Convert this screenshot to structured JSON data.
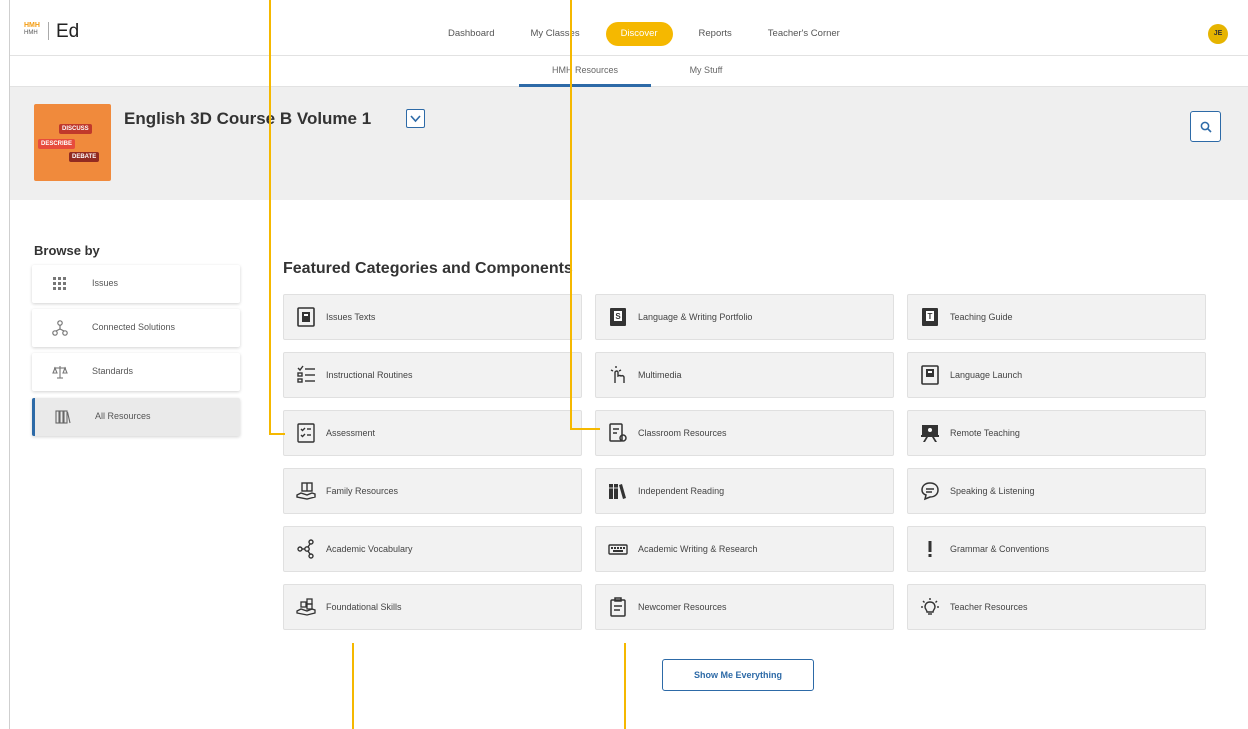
{
  "app": {
    "logo_top": "HMH",
    "logo_bottom": "HMH",
    "title": "Ed"
  },
  "nav": {
    "items": [
      "Dashboard",
      "My Classes",
      "Discover",
      "Reports",
      "Teacher's Corner"
    ],
    "active": "Discover",
    "avatar_initials": "JE"
  },
  "subnav": {
    "tabs": [
      "HMH Resources",
      "My Stuff"
    ],
    "active": "HMH Resources"
  },
  "banner": {
    "book_title": "English 3D Course B Volume 1",
    "cover_tags": [
      "DISCUSS",
      "DESCRIBE",
      "DEBATE"
    ]
  },
  "sidebar": {
    "title": "Browse by",
    "items": [
      {
        "label": "Issues",
        "icon": "grid-icon"
      },
      {
        "label": "Connected Solutions",
        "icon": "network-icon"
      },
      {
        "label": "Standards",
        "icon": "scales-icon"
      },
      {
        "label": "All Resources",
        "icon": "books-icon",
        "active": true
      }
    ]
  },
  "main": {
    "featured_title": "Featured Categories and Components",
    "cards": [
      {
        "label": "Issues Texts",
        "icon": "text-book-icon"
      },
      {
        "label": "Language & Writing Portfolio",
        "icon": "portfolio-book-icon"
      },
      {
        "label": "Teaching Guide",
        "icon": "teaching-guide-icon"
      },
      {
        "label": "Instructional Routines",
        "icon": "checklist-icon"
      },
      {
        "label": "Multimedia",
        "icon": "touch-icon"
      },
      {
        "label": "Language Launch",
        "icon": "launch-book-icon"
      },
      {
        "label": "Assessment",
        "icon": "assessment-icon"
      },
      {
        "label": "Classroom Resources",
        "icon": "classroom-resources-icon"
      },
      {
        "label": "Remote Teaching",
        "icon": "remote-teaching-icon"
      },
      {
        "label": "Family Resources",
        "icon": "family-icon"
      },
      {
        "label": "Independent Reading",
        "icon": "bookshelf-icon"
      },
      {
        "label": "Speaking & Listening",
        "icon": "speech-bubble-icon"
      },
      {
        "label": "Academic Vocabulary",
        "icon": "vocabulary-network-icon"
      },
      {
        "label": "Academic Writing & Research",
        "icon": "keyboard-icon"
      },
      {
        "label": "Grammar & Conventions",
        "icon": "exclamation-icon"
      },
      {
        "label": "Foundational Skills",
        "icon": "abc-blocks-icon"
      },
      {
        "label": "Newcomer Resources",
        "icon": "clipboard-icon"
      },
      {
        "label": "Teacher Resources",
        "icon": "lightbulb-icon"
      }
    ],
    "show_button": "Show Me Everything"
  },
  "colors": {
    "accent": "#f5b800",
    "primary": "#2d6aa7",
    "cover": "#f08a3c"
  }
}
